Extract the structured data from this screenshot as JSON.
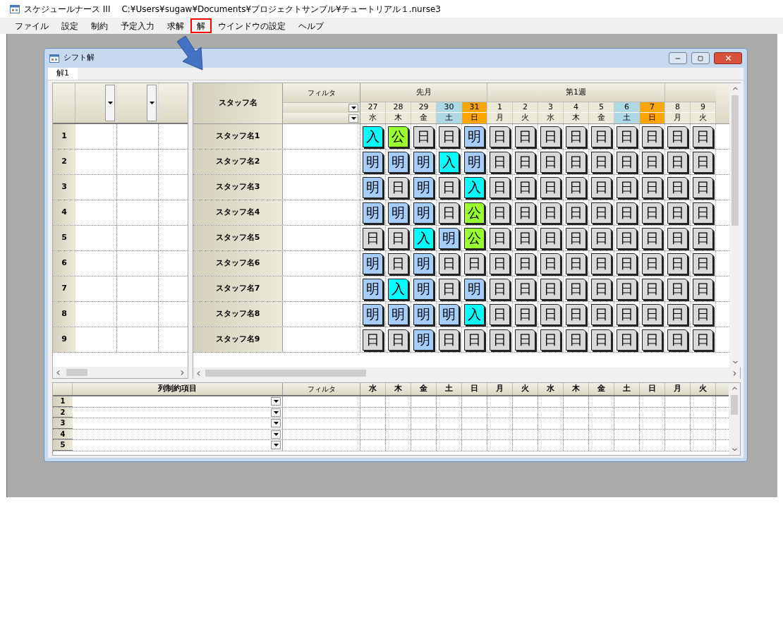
{
  "app": {
    "title": "スケジュールナース III",
    "path": "C:¥Users¥sugaw¥Documents¥プロジェクトサンプル¥チュートリアル１.nurse3"
  },
  "menu": [
    {
      "label": "ファイル",
      "highlighted": false
    },
    {
      "label": "設定",
      "highlighted": false
    },
    {
      "label": "制約",
      "highlighted": false
    },
    {
      "label": "予定入力",
      "highlighted": false
    },
    {
      "label": "求解",
      "highlighted": false
    },
    {
      "label": "解",
      "highlighted": true
    },
    {
      "label": "ウインドウの設定",
      "highlighted": false
    },
    {
      "label": "ヘルプ",
      "highlighted": false
    }
  ],
  "child_window": {
    "title": "シフト解",
    "tabs": [
      {
        "label": "解1",
        "selected": true
      }
    ]
  },
  "left_grid": {
    "rows": [
      "1",
      "2",
      "3",
      "4",
      "5",
      "6",
      "7",
      "8",
      "9"
    ]
  },
  "main_grid": {
    "staff_header": "スタッフ名",
    "filter_header": "フィルタ",
    "groups": [
      {
        "label": "先月",
        "days": [
          {
            "date": "27",
            "weekday": "水",
            "color": "#ece9d8"
          },
          {
            "date": "28",
            "weekday": "木",
            "color": "#ece9d8"
          },
          {
            "date": "29",
            "weekday": "金",
            "color": "#ece9d8"
          },
          {
            "date": "30",
            "weekday": "土",
            "color": "#add8e6"
          },
          {
            "date": "31",
            "weekday": "日",
            "color": "#ffa500"
          }
        ]
      },
      {
        "label": "第1週",
        "days": [
          {
            "date": "1",
            "weekday": "月",
            "color": "#ece9d8"
          },
          {
            "date": "2",
            "weekday": "火",
            "color": "#ece9d8"
          },
          {
            "date": "3",
            "weekday": "水",
            "color": "#ece9d8"
          },
          {
            "date": "4",
            "weekday": "木",
            "color": "#ece9d8"
          },
          {
            "date": "5",
            "weekday": "金",
            "color": "#ece9d8"
          },
          {
            "date": "6",
            "weekday": "土",
            "color": "#add8e6"
          },
          {
            "date": "7",
            "weekday": "日",
            "color": "#ffa500"
          }
        ]
      },
      {
        "days": [
          {
            "date": "8",
            "weekday": "月",
            "color": "#ece9d8"
          },
          {
            "date": "9",
            "weekday": "火",
            "color": "#ece9d8"
          }
        ]
      }
    ],
    "rows": [
      {
        "staff": "スタッフ名1",
        "shifts": [
          {
            "text": "入",
            "color": "#00ffff"
          },
          {
            "text": "公",
            "color": "#99ff33"
          },
          {
            "text": "日",
            "color": "#d9d9d9"
          },
          {
            "text": "日",
            "color": "#d9d9d9"
          },
          {
            "text": "明",
            "color": "#a6cdf7"
          },
          {
            "text": "日",
            "color": "#d9d9d9"
          },
          {
            "text": "日",
            "color": "#d9d9d9"
          },
          {
            "text": "日",
            "color": "#d9d9d9"
          },
          {
            "text": "日",
            "color": "#d9d9d9"
          },
          {
            "text": "日",
            "color": "#d9d9d9"
          },
          {
            "text": "日",
            "color": "#d9d9d9"
          },
          {
            "text": "日",
            "color": "#d9d9d9"
          },
          {
            "text": "日",
            "color": "#d9d9d9"
          },
          {
            "text": "日",
            "color": "#d9d9d9"
          }
        ]
      },
      {
        "staff": "スタッフ名2",
        "shifts": [
          {
            "text": "明",
            "color": "#a6cdf7"
          },
          {
            "text": "明",
            "color": "#a6cdf7"
          },
          {
            "text": "明",
            "color": "#a6cdf7"
          },
          {
            "text": "入",
            "color": "#00ffff"
          },
          {
            "text": "明",
            "color": "#a6cdf7"
          },
          {
            "text": "日",
            "color": "#d9d9d9"
          },
          {
            "text": "日",
            "color": "#d9d9d9"
          },
          {
            "text": "日",
            "color": "#d9d9d9"
          },
          {
            "text": "日",
            "color": "#d9d9d9"
          },
          {
            "text": "日",
            "color": "#d9d9d9"
          },
          {
            "text": "日",
            "color": "#d9d9d9"
          },
          {
            "text": "日",
            "color": "#d9d9d9"
          },
          {
            "text": "日",
            "color": "#d9d9d9"
          },
          {
            "text": "日",
            "color": "#d9d9d9"
          }
        ]
      },
      {
        "staff": "スタッフ名3",
        "shifts": [
          {
            "text": "明",
            "color": "#a6cdf7"
          },
          {
            "text": "日",
            "color": "#d9d9d9"
          },
          {
            "text": "明",
            "color": "#a6cdf7"
          },
          {
            "text": "日",
            "color": "#d9d9d9"
          },
          {
            "text": "入",
            "color": "#00ffff"
          },
          {
            "text": "日",
            "color": "#d9d9d9"
          },
          {
            "text": "日",
            "color": "#d9d9d9"
          },
          {
            "text": "日",
            "color": "#d9d9d9"
          },
          {
            "text": "日",
            "color": "#d9d9d9"
          },
          {
            "text": "日",
            "color": "#d9d9d9"
          },
          {
            "text": "日",
            "color": "#d9d9d9"
          },
          {
            "text": "日",
            "color": "#d9d9d9"
          },
          {
            "text": "日",
            "color": "#d9d9d9"
          },
          {
            "text": "日",
            "color": "#d9d9d9"
          }
        ]
      },
      {
        "staff": "スタッフ名4",
        "shifts": [
          {
            "text": "明",
            "color": "#a6cdf7"
          },
          {
            "text": "明",
            "color": "#a6cdf7"
          },
          {
            "text": "明",
            "color": "#a6cdf7"
          },
          {
            "text": "日",
            "color": "#d9d9d9"
          },
          {
            "text": "公",
            "color": "#99ff33"
          },
          {
            "text": "日",
            "color": "#d9d9d9"
          },
          {
            "text": "日",
            "color": "#d9d9d9"
          },
          {
            "text": "日",
            "color": "#d9d9d9"
          },
          {
            "text": "日",
            "color": "#d9d9d9"
          },
          {
            "text": "日",
            "color": "#d9d9d9"
          },
          {
            "text": "日",
            "color": "#d9d9d9"
          },
          {
            "text": "日",
            "color": "#d9d9d9"
          },
          {
            "text": "日",
            "color": "#d9d9d9"
          },
          {
            "text": "日",
            "color": "#d9d9d9"
          }
        ]
      },
      {
        "staff": "スタッフ名5",
        "shifts": [
          {
            "text": "日",
            "color": "#d9d9d9"
          },
          {
            "text": "日",
            "color": "#d9d9d9"
          },
          {
            "text": "入",
            "color": "#00ffff"
          },
          {
            "text": "明",
            "color": "#a6cdf7"
          },
          {
            "text": "公",
            "color": "#99ff33"
          },
          {
            "text": "日",
            "color": "#d9d9d9"
          },
          {
            "text": "日",
            "color": "#d9d9d9"
          },
          {
            "text": "日",
            "color": "#d9d9d9"
          },
          {
            "text": "日",
            "color": "#d9d9d9"
          },
          {
            "text": "日",
            "color": "#d9d9d9"
          },
          {
            "text": "日",
            "color": "#d9d9d9"
          },
          {
            "text": "日",
            "color": "#d9d9d9"
          },
          {
            "text": "日",
            "color": "#d9d9d9"
          },
          {
            "text": "日",
            "color": "#d9d9d9"
          }
        ]
      },
      {
        "staff": "スタッフ名6",
        "shifts": [
          {
            "text": "明",
            "color": "#a6cdf7"
          },
          {
            "text": "日",
            "color": "#d9d9d9"
          },
          {
            "text": "明",
            "color": "#a6cdf7"
          },
          {
            "text": "日",
            "color": "#d9d9d9"
          },
          {
            "text": "日",
            "color": "#d9d9d9"
          },
          {
            "text": "日",
            "color": "#d9d9d9"
          },
          {
            "text": "日",
            "color": "#d9d9d9"
          },
          {
            "text": "日",
            "color": "#d9d9d9"
          },
          {
            "text": "日",
            "color": "#d9d9d9"
          },
          {
            "text": "日",
            "color": "#d9d9d9"
          },
          {
            "text": "日",
            "color": "#d9d9d9"
          },
          {
            "text": "日",
            "color": "#d9d9d9"
          },
          {
            "text": "日",
            "color": "#d9d9d9"
          },
          {
            "text": "日",
            "color": "#d9d9d9"
          }
        ]
      },
      {
        "staff": "スタッフ名7",
        "shifts": [
          {
            "text": "明",
            "color": "#a6cdf7"
          },
          {
            "text": "入",
            "color": "#00ffff"
          },
          {
            "text": "明",
            "color": "#a6cdf7"
          },
          {
            "text": "日",
            "color": "#d9d9d9"
          },
          {
            "text": "明",
            "color": "#a6cdf7"
          },
          {
            "text": "日",
            "color": "#d9d9d9"
          },
          {
            "text": "日",
            "color": "#d9d9d9"
          },
          {
            "text": "日",
            "color": "#d9d9d9"
          },
          {
            "text": "日",
            "color": "#d9d9d9"
          },
          {
            "text": "日",
            "color": "#d9d9d9"
          },
          {
            "text": "日",
            "color": "#d9d9d9"
          },
          {
            "text": "日",
            "color": "#d9d9d9"
          },
          {
            "text": "日",
            "color": "#d9d9d9"
          },
          {
            "text": "日",
            "color": "#d9d9d9"
          }
        ]
      },
      {
        "staff": "スタッフ名8",
        "shifts": [
          {
            "text": "明",
            "color": "#a6cdf7"
          },
          {
            "text": "明",
            "color": "#a6cdf7"
          },
          {
            "text": "明",
            "color": "#a6cdf7"
          },
          {
            "text": "明",
            "color": "#a6cdf7"
          },
          {
            "text": "入",
            "color": "#00ffff"
          },
          {
            "text": "日",
            "color": "#d9d9d9"
          },
          {
            "text": "日",
            "color": "#d9d9d9"
          },
          {
            "text": "日",
            "color": "#d9d9d9"
          },
          {
            "text": "日",
            "color": "#d9d9d9"
          },
          {
            "text": "日",
            "color": "#d9d9d9"
          },
          {
            "text": "日",
            "color": "#d9d9d9"
          },
          {
            "text": "日",
            "color": "#d9d9d9"
          },
          {
            "text": "日",
            "color": "#d9d9d9"
          },
          {
            "text": "日",
            "color": "#d9d9d9"
          }
        ]
      },
      {
        "staff": "スタッフ名9",
        "shifts": [
          {
            "text": "日",
            "color": "#d9d9d9"
          },
          {
            "text": "日",
            "color": "#d9d9d9"
          },
          {
            "text": "明",
            "color": "#a6cdf7"
          },
          {
            "text": "日",
            "color": "#d9d9d9"
          },
          {
            "text": "日",
            "color": "#d9d9d9"
          },
          {
            "text": "日",
            "color": "#d9d9d9"
          },
          {
            "text": "日",
            "color": "#d9d9d9"
          },
          {
            "text": "日",
            "color": "#d9d9d9"
          },
          {
            "text": "日",
            "color": "#d9d9d9"
          },
          {
            "text": "日",
            "color": "#d9d9d9"
          },
          {
            "text": "日",
            "color": "#d9d9d9"
          },
          {
            "text": "日",
            "color": "#d9d9d9"
          },
          {
            "text": "日",
            "color": "#d9d9d9"
          },
          {
            "text": "日",
            "color": "#d9d9d9"
          }
        ]
      }
    ]
  },
  "bottom_grid": {
    "item_header": "列制約項目",
    "filter_header": "フィルタ",
    "weekdays": [
      "水",
      "木",
      "金",
      "土",
      "日",
      "月",
      "火",
      "水",
      "木",
      "金",
      "土",
      "日",
      "月",
      "火"
    ],
    "rows": [
      "1",
      "2",
      "3",
      "4",
      "5"
    ]
  }
}
